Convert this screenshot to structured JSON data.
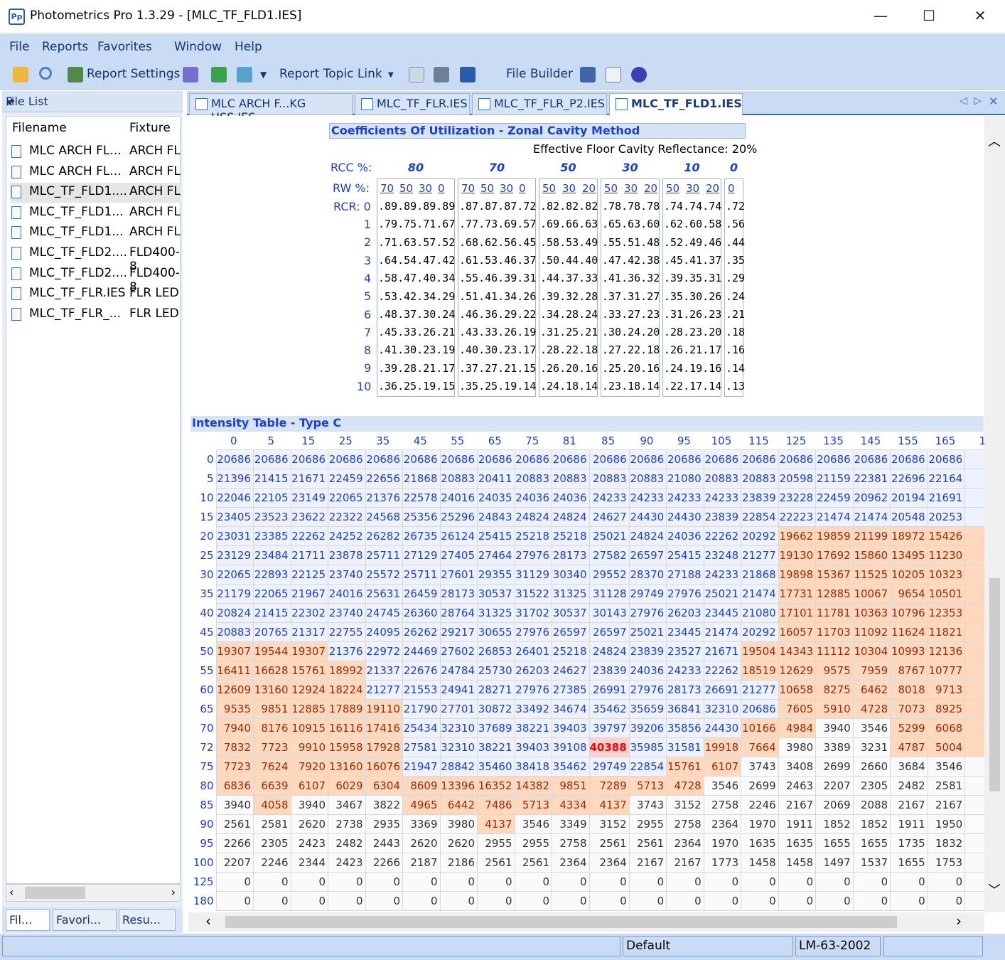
{
  "window": {
    "title": "Photometrics Pro 1.3.29 - [MLC_TF_FLD1.IES]",
    "app_icon": "Pp",
    "minimize": "—",
    "maximize": "☐",
    "close": "✕"
  },
  "menu": [
    "File",
    "Reports",
    "Favorites",
    "Window",
    "Help"
  ],
  "toolbar": {
    "report_settings": "Report Settings",
    "report_topic_link": "Report Topic Link",
    "file_builder": "File Builder"
  },
  "left_panel": {
    "title": "File List",
    "pin": "🖈",
    "col_filename": "Filename",
    "col_fixture": "Fixture",
    "files": [
      {
        "name": "MLC ARCH FL...",
        "fixture": "ARCH FL"
      },
      {
        "name": "MLC ARCH FL...",
        "fixture": "ARCH FL"
      },
      {
        "name": "MLC_TF_FLD1....",
        "fixture": "ARCH FL"
      },
      {
        "name": "MLC_TF_FLD1...",
        "fixture": "ARCH FL"
      },
      {
        "name": "MLC_TF_FLD1...",
        "fixture": "ARCH FL"
      },
      {
        "name": "MLC_TF_FLD2....",
        "fixture": "FLD400-8"
      },
      {
        "name": "MLC_TF_FLD2....",
        "fixture": "FLD400-8"
      },
      {
        "name": "MLC_TF_FLR.IES",
        "fixture": "FLR LED"
      },
      {
        "name": "MLC_TF_FLR_...",
        "fixture": "FLR LED"
      }
    ],
    "bottom_tabs": [
      "Fil...",
      "Favori...",
      "Resu..."
    ]
  },
  "doc_tabs": [
    "MLC ARCH F...KG HSS.IES",
    "MLC_TF_FLR.IES",
    "MLC_TF_FLR_P2.IES",
    "MLC_TF_FLD1.IES"
  ],
  "cu": {
    "title": "Coefficients Of Utilization - Zonal Cavity Method",
    "eff_floor": "Effective Floor Cavity Reflectance: 20%",
    "rcc_label": "RCC %:",
    "rw_label": "RW %:",
    "rcr_label": "RCR: 0",
    "rcc": [
      "80",
      "70",
      "50",
      "30",
      "10",
      "0"
    ],
    "rw": [
      [
        "70",
        "50",
        "30",
        "0"
      ],
      [
        "70",
        "50",
        "30",
        "0"
      ],
      [
        "50",
        "30",
        "20"
      ],
      [
        "50",
        "30",
        "20"
      ],
      [
        "50",
        "30",
        "20"
      ],
      [
        "0"
      ]
    ],
    "rcr": [
      "0",
      "1",
      "2",
      "3",
      "4",
      "5",
      "6",
      "7",
      "8",
      "9",
      "10"
    ],
    "rows": [
      [
        ".89.89.89.89",
        ".87.87.87.72",
        ".82.82.82",
        ".78.78.78",
        ".74.74.74",
        ".72"
      ],
      [
        ".79.75.71.67",
        ".77.73.69.57",
        ".69.66.63",
        ".65.63.60",
        ".62.60.58",
        ".56"
      ],
      [
        ".71.63.57.52",
        ".68.62.56.45",
        ".58.53.49",
        ".55.51.48",
        ".52.49.46",
        ".44"
      ],
      [
        ".64.54.47.42",
        ".61.53.46.37",
        ".50.44.40",
        ".47.42.38",
        ".45.41.37",
        ".35"
      ],
      [
        ".58.47.40.34",
        ".55.46.39.31",
        ".44.37.33",
        ".41.36.32",
        ".39.35.31",
        ".29"
      ],
      [
        ".53.42.34.29",
        ".51.41.34.26",
        ".39.32.28",
        ".37.31.27",
        ".35.30.26",
        ".24"
      ],
      [
        ".48.37.30.24",
        ".46.36.29.22",
        ".34.28.24",
        ".33.27.23",
        ".31.26.23",
        ".21"
      ],
      [
        ".45.33.26.21",
        ".43.33.26.19",
        ".31.25.21",
        ".30.24.20",
        ".28.23.20",
        ".18"
      ],
      [
        ".41.30.23.19",
        ".40.30.23.17",
        ".28.22.18",
        ".27.22.18",
        ".26.21.17",
        ".16"
      ],
      [
        ".39.28.21.17",
        ".37.27.21.15",
        ".26.20.16",
        ".25.20.16",
        ".24.19.16",
        ".14"
      ],
      [
        ".36.25.19.15",
        ".35.25.19.14",
        ".24.18.14",
        ".23.18.14",
        ".22.17.14",
        ".13"
      ]
    ]
  },
  "intensity": {
    "title": "Intensity Table - Type C",
    "h_angles": [
      "0",
      "5",
      "15",
      "25",
      "35",
      "45",
      "55",
      "65",
      "75",
      "81",
      "85",
      "90",
      "95",
      "105",
      "115",
      "125",
      "135",
      "145",
      "155",
      "165",
      "1"
    ],
    "rows": [
      {
        "v": "0",
        "c": [
          "20686",
          "20686",
          "20686",
          "20686",
          "20686",
          "20686",
          "20686",
          "20686",
          "20686",
          "20686",
          "20686",
          "20686",
          "20686",
          "20686",
          "20686",
          "20686",
          "20686",
          "20686",
          "20686",
          "20686",
          "20"
        ],
        "t": "bbbbbbbbbbbbbbbbbbbbb"
      },
      {
        "v": "5",
        "c": [
          "21396",
          "21415",
          "21671",
          "22459",
          "22656",
          "21868",
          "20883",
          "20411",
          "20883",
          "20883",
          "20883",
          "20883",
          "21080",
          "20883",
          "20883",
          "20598",
          "21159",
          "22381",
          "22696",
          "22164",
          "22"
        ],
        "t": "bbbbbbbbbbbbbbbbbbbbb"
      },
      {
        "v": "10",
        "c": [
          "22046",
          "22105",
          "23149",
          "22065",
          "21376",
          "22578",
          "24016",
          "24035",
          "24036",
          "24036",
          "24233",
          "24233",
          "24233",
          "24233",
          "23839",
          "23228",
          "22459",
          "20962",
          "20194",
          "21691",
          "20"
        ],
        "t": "bbbbbbbbbbbbbbbbbbbbb"
      },
      {
        "v": "15",
        "c": [
          "23405",
          "23523",
          "23622",
          "22322",
          "24568",
          "25356",
          "25296",
          "24843",
          "24824",
          "24824",
          "24627",
          "24430",
          "24430",
          "23839",
          "22854",
          "22223",
          "21474",
          "21474",
          "20548",
          "20253",
          "20"
        ],
        "t": "bbbbbbbbbbbbbbbbbbbbb"
      },
      {
        "v": "20",
        "c": [
          "23031",
          "23385",
          "22262",
          "24252",
          "26282",
          "26735",
          "26124",
          "25415",
          "25218",
          "25218",
          "25021",
          "24824",
          "24036",
          "22262",
          "20292",
          "19662",
          "19859",
          "21199",
          "18972",
          "15426",
          "15"
        ],
        "t": "bbbbbbbbbbbbbbbrrrrrr"
      },
      {
        "v": "25",
        "c": [
          "23129",
          "23484",
          "21711",
          "23878",
          "25711",
          "27129",
          "27405",
          "27464",
          "27976",
          "28173",
          "27582",
          "26597",
          "25415",
          "23248",
          "21277",
          "19130",
          "17692",
          "15860",
          "13495",
          "11230",
          "11"
        ],
        "t": "bbbbbbbbbbbbbbbrrrrrr"
      },
      {
        "v": "30",
        "c": [
          "22065",
          "22893",
          "22125",
          "23740",
          "25572",
          "25711",
          "27601",
          "29355",
          "31129",
          "30340",
          "29552",
          "28370",
          "27188",
          "24233",
          "21868",
          "19898",
          "15367",
          "11525",
          "10205",
          "10323",
          "10"
        ],
        "t": "bbbbbbbbbbbbbbbrrrrrr"
      },
      {
        "v": "35",
        "c": [
          "21179",
          "22065",
          "21967",
          "24016",
          "25631",
          "26459",
          "28173",
          "30537",
          "31522",
          "31325",
          "31128",
          "29749",
          "27976",
          "25021",
          "21474",
          "17731",
          "12885",
          "10067",
          "9654",
          "10501",
          "11"
        ],
        "t": "bbbbbbbbbbbbbbbrrrrrr"
      },
      {
        "v": "40",
        "c": [
          "20824",
          "21415",
          "22302",
          "23740",
          "24745",
          "26360",
          "28764",
          "31325",
          "31702",
          "30537",
          "30143",
          "27976",
          "26203",
          "23445",
          "21080",
          "17101",
          "11781",
          "10363",
          "10796",
          "12353",
          "12"
        ],
        "t": "bbbbbbbbbbbbbbbrrrrrr"
      },
      {
        "v": "45",
        "c": [
          "20883",
          "20765",
          "21317",
          "22755",
          "24095",
          "26262",
          "29217",
          "30655",
          "27976",
          "26597",
          "26597",
          "25021",
          "23445",
          "21474",
          "20292",
          "16057",
          "11703",
          "11092",
          "11624",
          "11821",
          "11"
        ],
        "t": "bbbbbbbbbbbbbbbrrrrrr"
      },
      {
        "v": "50",
        "c": [
          "19307",
          "19544",
          "19307",
          "21376",
          "22972",
          "24469",
          "27602",
          "26853",
          "26401",
          "25218",
          "24824",
          "23839",
          "23527",
          "21671",
          "19504",
          "14343",
          "11112",
          "10304",
          "10993",
          "12136",
          "12"
        ],
        "t": "rrrbbbbbbbbbbbrrrrrrr"
      },
      {
        "v": "55",
        "c": [
          "16411",
          "16628",
          "15761",
          "18992",
          "21337",
          "22676",
          "24784",
          "25730",
          "26203",
          "24627",
          "23839",
          "24036",
          "24233",
          "22262",
          "18519",
          "12629",
          "9575",
          "7959",
          "8767",
          "10777",
          "10"
        ],
        "t": "rrrrbbbbbbbbbbrrrrrrr"
      },
      {
        "v": "60",
        "c": [
          "12609",
          "13160",
          "12924",
          "18224",
          "21277",
          "21553",
          "24941",
          "28271",
          "27976",
          "27385",
          "26991",
          "27976",
          "28173",
          "26691",
          "21277",
          "10658",
          "8275",
          "6462",
          "8018",
          "9713",
          "8"
        ],
        "t": "rrrrbbbbbbbbbbbrrrrrr"
      },
      {
        "v": "65",
        "c": [
          "9535",
          "9851",
          "12885",
          "17889",
          "19110",
          "21790",
          "27701",
          "30872",
          "33492",
          "34674",
          "35462",
          "35659",
          "36841",
          "32310",
          "20686",
          "7605",
          "5910",
          "4728",
          "7073",
          "8925",
          "6"
        ],
        "t": "rrrrrbbbbbbbbbbrrrrrr"
      },
      {
        "v": "70",
        "c": [
          "7940",
          "8176",
          "10915",
          "16116",
          "17416",
          "25434",
          "32310",
          "37689",
          "38221",
          "39403",
          "39797",
          "39206",
          "35856",
          "24430",
          "10166",
          "4984",
          "3940",
          "3546",
          "5299",
          "6068",
          "4"
        ],
        "t": "rrrrrbbbbbbbbbrrkkrrr"
      },
      {
        "v": "72",
        "c": [
          "7832",
          "7723",
          "9910",
          "15958",
          "17928",
          "27581",
          "32310",
          "38221",
          "39403",
          "39108",
          "40388",
          "35985",
          "31581",
          "19918",
          "7664",
          "3980",
          "3389",
          "3231",
          "4787",
          "5004",
          "4"
        ],
        "t": "rrrrrbbbbbhbbrrkkkrrr"
      },
      {
        "v": "75",
        "c": [
          "7723",
          "7624",
          "7920",
          "13160",
          "16076",
          "21947",
          "28842",
          "35460",
          "38418",
          "35462",
          "29749",
          "22854",
          "15761",
          "6107",
          "3743",
          "3408",
          "2699",
          "2660",
          "3684",
          "3546",
          "3"
        ],
        "t": "rrrrrbbbbbbbrrkkkkkkk"
      },
      {
        "v": "80",
        "c": [
          "6836",
          "6639",
          "6107",
          "6029",
          "6304",
          "8609",
          "13396",
          "16352",
          "14382",
          "9851",
          "7289",
          "5713",
          "4728",
          "3546",
          "2699",
          "2463",
          "2207",
          "2305",
          "2482",
          "2581",
          "2"
        ],
        "t": "rrrrrrrrrrrrrkkkkkkkk"
      },
      {
        "v": "85",
        "c": [
          "3940",
          "4058",
          "3940",
          "3467",
          "3822",
          "4965",
          "6442",
          "7486",
          "5713",
          "4334",
          "4137",
          "3743",
          "3152",
          "2758",
          "2246",
          "2167",
          "2069",
          "2088",
          "2167",
          "2167",
          "2"
        ],
        "t": "krkkkrrrrrrkkkkkkkkkk"
      },
      {
        "v": "90",
        "c": [
          "2561",
          "2581",
          "2620",
          "2738",
          "2935",
          "3369",
          "3980",
          "4137",
          "3546",
          "3349",
          "3152",
          "2955",
          "2758",
          "2364",
          "1970",
          "1911",
          "1852",
          "1852",
          "1911",
          "1950",
          "1"
        ],
        "t": "kkkkkkkrkkkkkkkkkkkkk"
      },
      {
        "v": "95",
        "c": [
          "2266",
          "2305",
          "2423",
          "2482",
          "2443",
          "2620",
          "2620",
          "2955",
          "2955",
          "2758",
          "2561",
          "2561",
          "2364",
          "1970",
          "1635",
          "1635",
          "1655",
          "1655",
          "1735",
          "1832",
          "1"
        ],
        "t": "kkkkkkkkkkkkkkkkkkkkk"
      },
      {
        "v": "100",
        "c": [
          "2207",
          "2246",
          "2344",
          "2423",
          "2266",
          "2187",
          "2186",
          "2561",
          "2561",
          "2364",
          "2364",
          "2167",
          "2167",
          "1773",
          "1458",
          "1458",
          "1497",
          "1537",
          "1655",
          "1753",
          "1"
        ],
        "t": "kkkkkkkkkkkkkkkkkkkkk"
      },
      {
        "v": "125",
        "c": [
          "0",
          "0",
          "0",
          "0",
          "0",
          "0",
          "0",
          "0",
          "0",
          "0",
          "0",
          "0",
          "0",
          "0",
          "0",
          "0",
          "0",
          "0",
          "0",
          "0",
          "0"
        ],
        "t": "kkkkkkkkkkkkkkkkkkkkk"
      },
      {
        "v": "180",
        "c": [
          "0",
          "0",
          "0",
          "0",
          "0",
          "0",
          "0",
          "0",
          "0",
          "0",
          "0",
          "0",
          "0",
          "0",
          "0",
          "0",
          "0",
          "0",
          "0",
          "0",
          "0"
        ],
        "t": "kkkkkkkkkkkkkkkkkkkkk"
      }
    ]
  },
  "status": {
    "default": "Default",
    "standard": "LM-63-2002"
  }
}
